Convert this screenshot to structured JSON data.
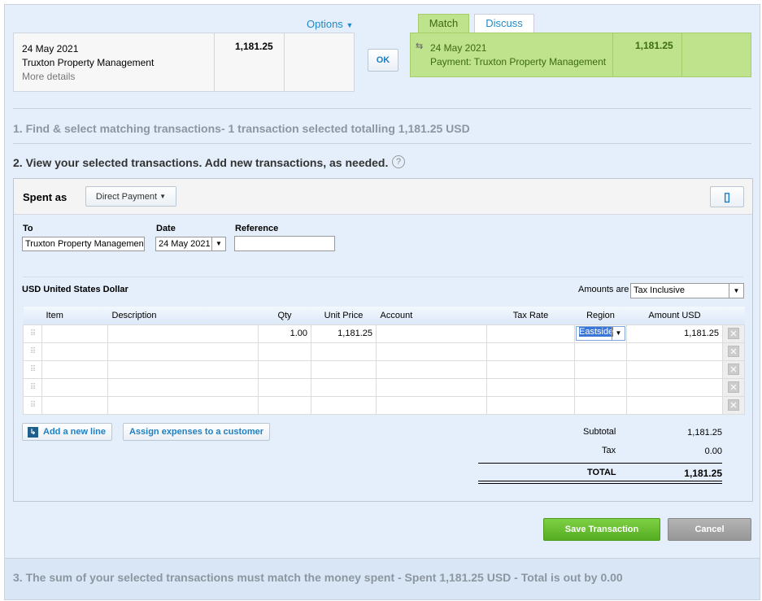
{
  "options_label": "Options",
  "statement": {
    "date": "24 May 2021",
    "payee": "Truxton Property Management",
    "more": "More details",
    "amount": "1,181.25"
  },
  "ok_label": "OK",
  "tabs": [
    "Match",
    "Discuss"
  ],
  "match": {
    "date": "24 May 2021",
    "desc": "Payment: Truxton Property Management",
    "amount": "1,181.25"
  },
  "step1": "1. Find & select matching transactions- 1 transaction selected totalling 1,181.25 USD",
  "step2": "2. View your selected transactions. Add new transactions, as needed.",
  "help": "?",
  "spent_as": "Spent as",
  "spent_type": "Direct Payment",
  "form": {
    "to_label": "To",
    "to_value": "Truxton Property Managemen",
    "date_label": "Date",
    "date_value": "24 May 2021",
    "ref_label": "Reference",
    "ref_value": ""
  },
  "currency": "USD United States Dollar",
  "amounts_are_label": "Amounts are",
  "amounts_are_value": "Tax Inclusive",
  "columns": [
    "Item",
    "Description",
    "Qty",
    "Unit Price",
    "Account",
    "Tax Rate",
    "Region",
    "Amount USD"
  ],
  "row1": {
    "qty": "1.00",
    "unit_price": "1,181.25",
    "region": "Eastside",
    "amount": "1,181.25"
  },
  "add_line": "Add a new line",
  "assign": "Assign expenses to a customer",
  "totals": {
    "subtotal_label": "Subtotal",
    "subtotal": "1,181.25",
    "tax_label": "Tax",
    "tax": "0.00",
    "total_label": "TOTAL",
    "total": "1,181.25"
  },
  "save": "Save Transaction",
  "cancel": "Cancel",
  "step3": "3. The sum of your selected transactions must match the money spent - Spent 1,181.25 USD - Total is out by 0.00"
}
